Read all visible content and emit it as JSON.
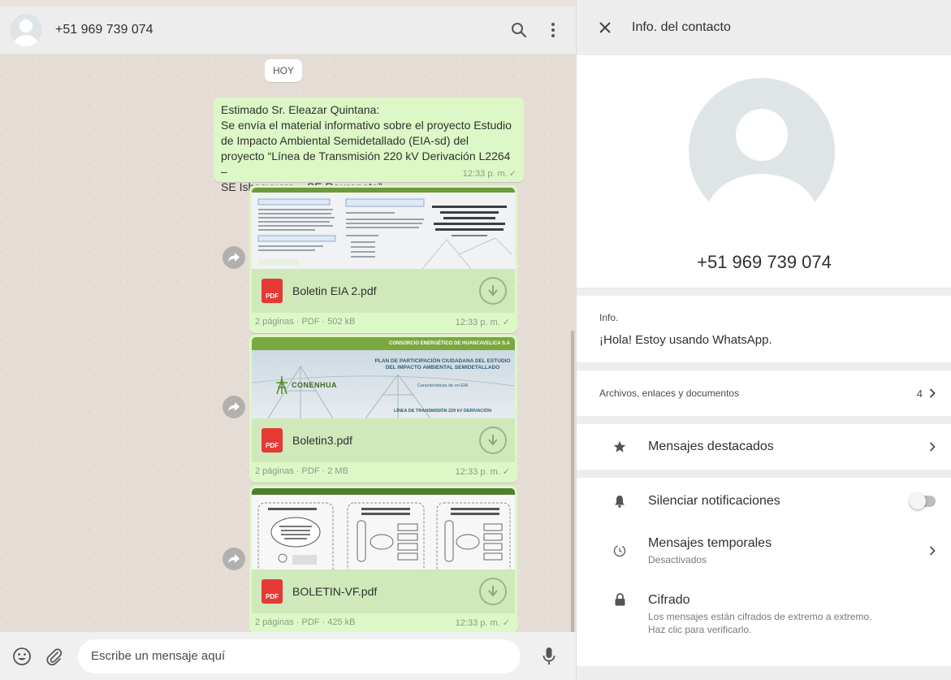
{
  "chat_header": {
    "contact_name": "+51 969 739 074"
  },
  "chat": {
    "day_label": "HOY",
    "text_message": {
      "lines": [
        "Estimado Sr. Eleazar Quintana:",
        "Se envía el material informativo sobre el proyecto Estudio",
        "de Impacto Ambiental Semidetallado (EIA-sd) del",
        "proyecto “Línea de Transmisión 220 kV Derivación L2264 –",
        "SE Ishcayucro – SE Raurapata”."
      ],
      "time": "12:33 p. m."
    },
    "documents": [
      {
        "name": "Boletin EIA 2.pdf",
        "info": "2 páginas · PDF · 502 kB",
        "time": "12:33 p. m.",
        "thumb_title": "ESTUDIO DE IMPACTO AMBIENTAL SD LÍNEA DE TRANSMISIÓN 220 KV DERIVACIÓN L2264 – SE ISHCAYUCRO – SE RAURAPATA"
      },
      {
        "name": "Boletin3.pdf",
        "info": "2 páginas · PDF · 2 MB",
        "time": "12:33 p. m.",
        "thumb_header": "CONSORCIO ENERGÉTICO DE HUANCAVELICA S.A",
        "thumb_title": "PLAN DE PARTICIPACIÓN CIUDADANA DEL ESTUDIO DEL IMPACTO AMBIENTAL SEMIDETALLADO",
        "thumb_sub": "Características de un EIA",
        "thumb_footer": "LÍNEA DE TRANSMISIÓN 220 kV DERIVACIÓN",
        "thumb_brand": "CONENHUA"
      },
      {
        "name": "BOLETIN-VF.pdf",
        "info": "2 páginas · PDF · 425 kB",
        "time": "12:33 p. m."
      }
    ],
    "pdf_badge": "PDF"
  },
  "compose": {
    "placeholder": "Escribe un mensaje aquí"
  },
  "contact_info": {
    "header_title": "Info. del contacto",
    "phone": "+51 969 739 074",
    "about_label": "Info.",
    "about_text": "¡Hola! Estoy usando WhatsApp.",
    "media_label": "Archivos, enlaces y documentos",
    "media_count": "4",
    "starred_label": "Mensajes destacados",
    "mute_label": "Silenciar notificaciones",
    "mute_enabled": false,
    "disappearing_label": "Mensajes temporales",
    "disappearing_status": "Desactivados",
    "encryption_label": "Cifrado",
    "encryption_line1": "Los mensajes están cifrados de extremo a extremo.",
    "encryption_line2": "Haz clic para verificarlo."
  },
  "colors": {
    "outgoing_bubble": "#dcf8c6",
    "chat_background": "#e5ddd5",
    "header_background": "#ededed",
    "pdf_red": "#e53935",
    "thumb_green": "#6a9b3a"
  }
}
